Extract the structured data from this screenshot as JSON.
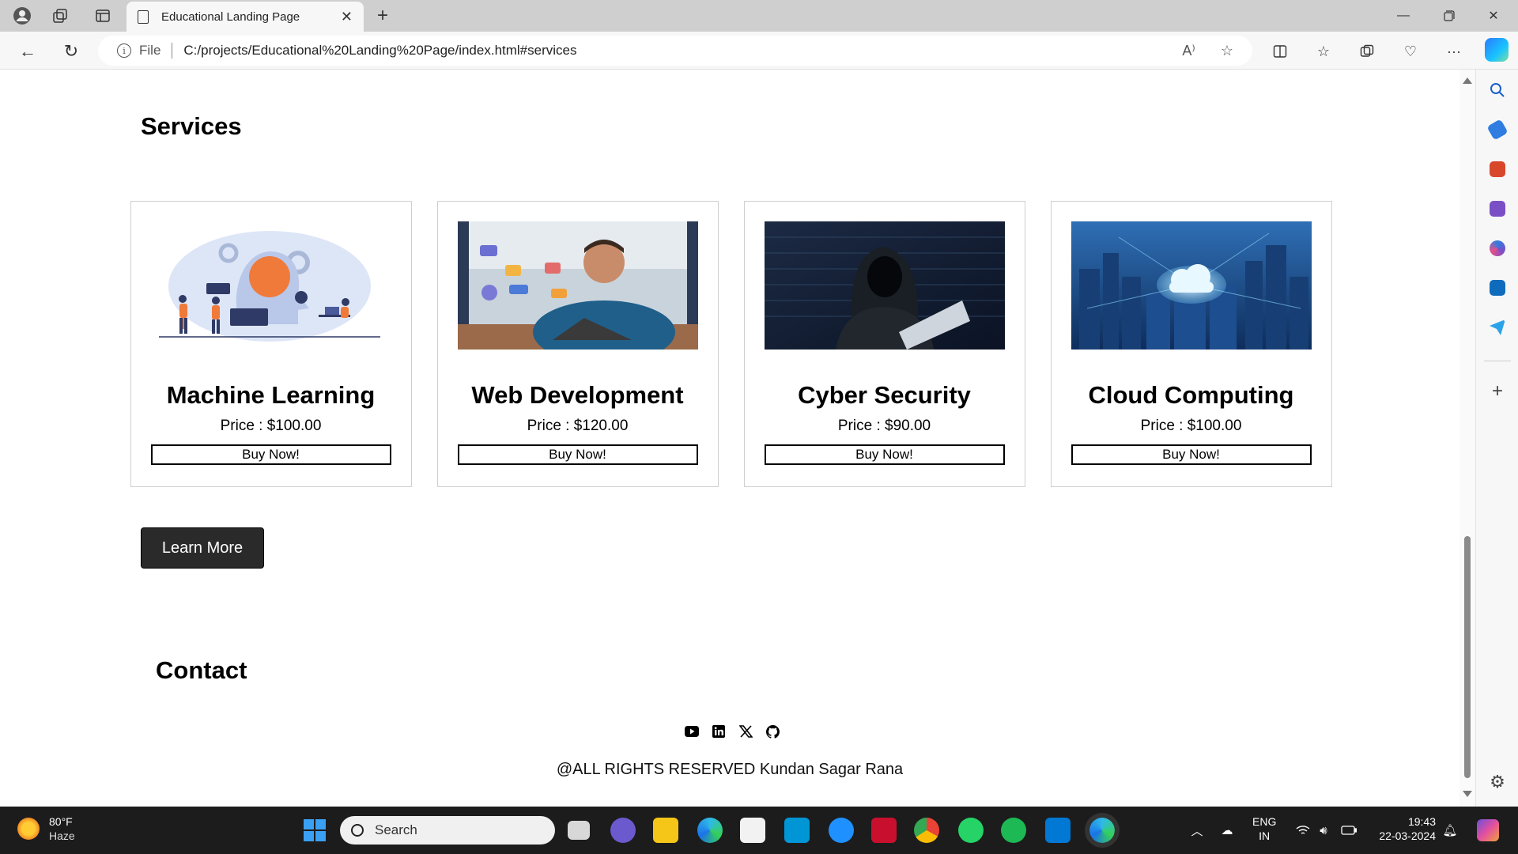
{
  "browser": {
    "tab_title": "Educational Landing Page",
    "url_scheme": "File",
    "url": "C:/projects/Educational%20Landing%20Page/index.html#services"
  },
  "services": {
    "heading": "Services",
    "cards": [
      {
        "title": "Machine Learning",
        "price": "Price : $100.00",
        "button": "Buy Now!",
        "image": "machine-learning-illustration"
      },
      {
        "title": "Web Development",
        "price": "Price : $120.00",
        "button": "Buy Now!",
        "image": "web-developer-photo"
      },
      {
        "title": "Cyber Security",
        "price": "Price : $90.00",
        "button": "Buy Now!",
        "image": "hooded-hacker-photo"
      },
      {
        "title": "Cloud Computing",
        "price": "Price : $100.00",
        "button": "Buy Now!",
        "image": "cloud-city-photo"
      }
    ],
    "learn_more": "Learn More"
  },
  "contact": {
    "heading": "Contact",
    "socials": [
      "youtube-icon",
      "linkedin-icon",
      "x-icon",
      "github-icon"
    ],
    "footer": "@ALL RIGHTS RESERVED Kundan Sagar Rana"
  },
  "taskbar": {
    "temp": "80°F",
    "condition": "Haze",
    "search": "Search",
    "lang_top": "ENG",
    "lang_bottom": "IN",
    "time": "19:43",
    "date": "22-03-2024"
  }
}
